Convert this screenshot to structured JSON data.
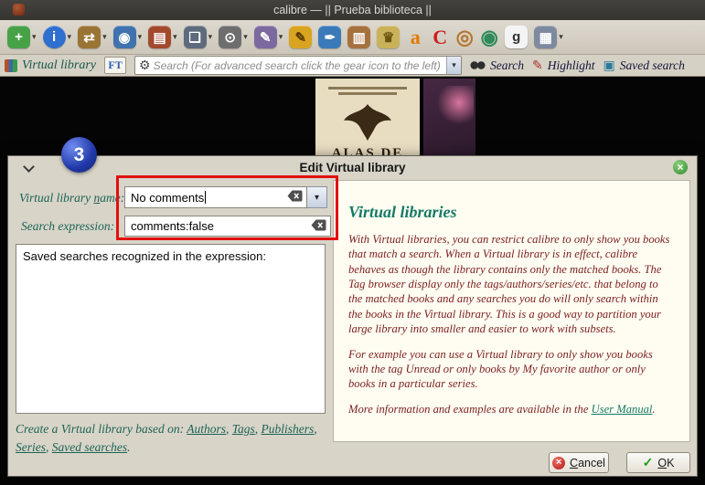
{
  "window": {
    "title": "calibre — || Prueba biblioteca ||"
  },
  "toolbar": {
    "icons": [
      {
        "name": "add-books",
        "glyph": "+",
        "bg": "#47a247",
        "fg": "#ffffff",
        "dd": true
      },
      {
        "name": "edit-metadata",
        "glyph": "i",
        "bg": "#2e6fd0",
        "fg": "#ffffff",
        "dd": true,
        "round": true
      },
      {
        "name": "convert-books",
        "glyph": "⇄",
        "bg": "#9a7434",
        "fg": "#ffffff",
        "dd": true
      },
      {
        "name": "view-book",
        "glyph": "◉",
        "bg": "#3f72ae",
        "fg": "#ffffff",
        "dd": true
      },
      {
        "name": "send-to-device",
        "glyph": "▤",
        "bg": "#a34a2e",
        "fg": "#ffffff",
        "dd": true
      },
      {
        "name": "preview-book",
        "glyph": "❏",
        "bg": "#5d6b7d",
        "fg": "#ffffff",
        "dd": true
      },
      {
        "name": "search-magnifier",
        "glyph": "⊙",
        "bg": "#6e6e6e",
        "fg": "#ffffff",
        "dd": true
      },
      {
        "name": "edit-book",
        "glyph": "✎",
        "bg": "#7a6aa0",
        "fg": "#ffffff",
        "dd": true
      },
      {
        "name": "polish-books",
        "glyph": "✎",
        "bg": "#d9a520",
        "fg": "#5a3a00",
        "dd": false
      },
      {
        "name": "mark-books",
        "glyph": "✒",
        "bg": "#3a7ab8",
        "fg": "#ffffff",
        "dd": false
      },
      {
        "name": "library-stats",
        "glyph": "▥",
        "bg": "#a5713d",
        "fg": "#ffffff",
        "dd": false
      },
      {
        "name": "trophy",
        "glyph": "♛",
        "bg": "#c9b25a",
        "fg": "#6a5410",
        "dd": false
      },
      {
        "name": "amazon",
        "glyph": "a",
        "fg": "#e07b00",
        "flat": true,
        "dd": false
      },
      {
        "name": "calibre-store",
        "glyph": "C",
        "fg": "#cc1f1f",
        "flat": true,
        "dd": false
      },
      {
        "name": "donate",
        "glyph": "◎",
        "fg": "#b5762f",
        "flat": true,
        "dd": false
      },
      {
        "name": "news",
        "glyph": "◉",
        "fg": "#2f8a5a",
        "flat": true,
        "dd": false
      },
      {
        "name": "goodreads",
        "glyph": "g",
        "bg": "#f4f4f4",
        "fg": "#333333",
        "dd": false
      },
      {
        "name": "layout-columns",
        "glyph": "▦",
        "bg": "#7d8aa0",
        "fg": "#ffffff",
        "dd": true
      }
    ]
  },
  "searchbar": {
    "virtual_library": "Virtual library",
    "ft": "FT",
    "placeholder": "Search (For advanced search click the gear icon to the left)",
    "search": "Search",
    "highlight": "Highlight",
    "saved_search": "Saved search"
  },
  "covers": {
    "cover1_title": "ALAS DE"
  },
  "dialog": {
    "title": "Edit Virtual library",
    "name_label_pre": "Virtual library ",
    "name_label_accel": "n",
    "name_label_post": "ame:",
    "name_value": "No comments",
    "expr_label": "Search expression:",
    "expr_value": "comments:false",
    "saved_box_label": "Saved searches recognized in the expression:",
    "create_prefix": "Create a Virtual library based on: ",
    "links": [
      "Authors",
      "Tags",
      "Publishers",
      "Series",
      "Saved searches"
    ],
    "sep": ", ",
    "period": ".",
    "info": {
      "heading": "Virtual libraries",
      "p1": "With Virtual libraries, you can restrict calibre to only show you books that match a search. When a Virtual library is in effect, calibre behaves as though the library contains only the matched books. The Tag browser display only the tags/authors/series/etc. that belong to the matched books and any searches you do will only search within the books in the Virtual library. This is a good way to partition your large library into smaller and easier to work with subsets.",
      "p2": "For example you can use a Virtual library to only show you books with the tag Unread or only books by My favorite author or only books in a particular series.",
      "p3_pre": "More information and examples are available in the ",
      "p3_link": "User Manual",
      "p3_post": "."
    },
    "buttons": {
      "cancel_accel": "C",
      "cancel_rest": "ancel",
      "ok_accel": "O",
      "ok_rest": "K"
    }
  },
  "annotation": {
    "step": "3",
    "highlight_color": "#e21010",
    "badge_color": "#2038a8"
  }
}
